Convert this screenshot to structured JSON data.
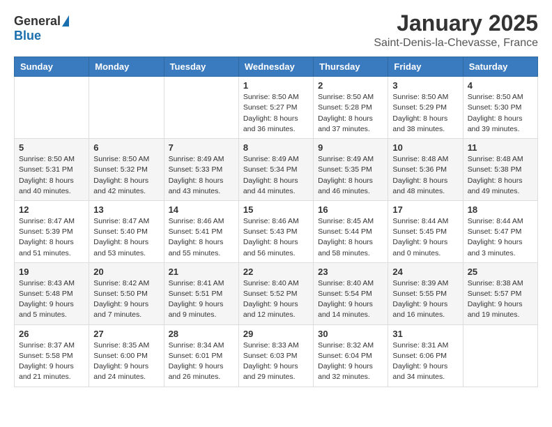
{
  "header": {
    "logo_general": "General",
    "logo_blue": "Blue",
    "title": "January 2025",
    "subtitle": "Saint-Denis-la-Chevasse, France"
  },
  "days_of_week": [
    "Sunday",
    "Monday",
    "Tuesday",
    "Wednesday",
    "Thursday",
    "Friday",
    "Saturday"
  ],
  "weeks": [
    [
      {
        "day": "",
        "info": ""
      },
      {
        "day": "",
        "info": ""
      },
      {
        "day": "",
        "info": ""
      },
      {
        "day": "1",
        "info": "Sunrise: 8:50 AM\nSunset: 5:27 PM\nDaylight: 8 hours and 36 minutes."
      },
      {
        "day": "2",
        "info": "Sunrise: 8:50 AM\nSunset: 5:28 PM\nDaylight: 8 hours and 37 minutes."
      },
      {
        "day": "3",
        "info": "Sunrise: 8:50 AM\nSunset: 5:29 PM\nDaylight: 8 hours and 38 minutes."
      },
      {
        "day": "4",
        "info": "Sunrise: 8:50 AM\nSunset: 5:30 PM\nDaylight: 8 hours and 39 minutes."
      }
    ],
    [
      {
        "day": "5",
        "info": "Sunrise: 8:50 AM\nSunset: 5:31 PM\nDaylight: 8 hours and 40 minutes."
      },
      {
        "day": "6",
        "info": "Sunrise: 8:50 AM\nSunset: 5:32 PM\nDaylight: 8 hours and 42 minutes."
      },
      {
        "day": "7",
        "info": "Sunrise: 8:49 AM\nSunset: 5:33 PM\nDaylight: 8 hours and 43 minutes."
      },
      {
        "day": "8",
        "info": "Sunrise: 8:49 AM\nSunset: 5:34 PM\nDaylight: 8 hours and 44 minutes."
      },
      {
        "day": "9",
        "info": "Sunrise: 8:49 AM\nSunset: 5:35 PM\nDaylight: 8 hours and 46 minutes."
      },
      {
        "day": "10",
        "info": "Sunrise: 8:48 AM\nSunset: 5:36 PM\nDaylight: 8 hours and 48 minutes."
      },
      {
        "day": "11",
        "info": "Sunrise: 8:48 AM\nSunset: 5:38 PM\nDaylight: 8 hours and 49 minutes."
      }
    ],
    [
      {
        "day": "12",
        "info": "Sunrise: 8:47 AM\nSunset: 5:39 PM\nDaylight: 8 hours and 51 minutes."
      },
      {
        "day": "13",
        "info": "Sunrise: 8:47 AM\nSunset: 5:40 PM\nDaylight: 8 hours and 53 minutes."
      },
      {
        "day": "14",
        "info": "Sunrise: 8:46 AM\nSunset: 5:41 PM\nDaylight: 8 hours and 55 minutes."
      },
      {
        "day": "15",
        "info": "Sunrise: 8:46 AM\nSunset: 5:43 PM\nDaylight: 8 hours and 56 minutes."
      },
      {
        "day": "16",
        "info": "Sunrise: 8:45 AM\nSunset: 5:44 PM\nDaylight: 8 hours and 58 minutes."
      },
      {
        "day": "17",
        "info": "Sunrise: 8:44 AM\nSunset: 5:45 PM\nDaylight: 9 hours and 0 minutes."
      },
      {
        "day": "18",
        "info": "Sunrise: 8:44 AM\nSunset: 5:47 PM\nDaylight: 9 hours and 3 minutes."
      }
    ],
    [
      {
        "day": "19",
        "info": "Sunrise: 8:43 AM\nSunset: 5:48 PM\nDaylight: 9 hours and 5 minutes."
      },
      {
        "day": "20",
        "info": "Sunrise: 8:42 AM\nSunset: 5:50 PM\nDaylight: 9 hours and 7 minutes."
      },
      {
        "day": "21",
        "info": "Sunrise: 8:41 AM\nSunset: 5:51 PM\nDaylight: 9 hours and 9 minutes."
      },
      {
        "day": "22",
        "info": "Sunrise: 8:40 AM\nSunset: 5:52 PM\nDaylight: 9 hours and 12 minutes."
      },
      {
        "day": "23",
        "info": "Sunrise: 8:40 AM\nSunset: 5:54 PM\nDaylight: 9 hours and 14 minutes."
      },
      {
        "day": "24",
        "info": "Sunrise: 8:39 AM\nSunset: 5:55 PM\nDaylight: 9 hours and 16 minutes."
      },
      {
        "day": "25",
        "info": "Sunrise: 8:38 AM\nSunset: 5:57 PM\nDaylight: 9 hours and 19 minutes."
      }
    ],
    [
      {
        "day": "26",
        "info": "Sunrise: 8:37 AM\nSunset: 5:58 PM\nDaylight: 9 hours and 21 minutes."
      },
      {
        "day": "27",
        "info": "Sunrise: 8:35 AM\nSunset: 6:00 PM\nDaylight: 9 hours and 24 minutes."
      },
      {
        "day": "28",
        "info": "Sunrise: 8:34 AM\nSunset: 6:01 PM\nDaylight: 9 hours and 26 minutes."
      },
      {
        "day": "29",
        "info": "Sunrise: 8:33 AM\nSunset: 6:03 PM\nDaylight: 9 hours and 29 minutes."
      },
      {
        "day": "30",
        "info": "Sunrise: 8:32 AM\nSunset: 6:04 PM\nDaylight: 9 hours and 32 minutes."
      },
      {
        "day": "31",
        "info": "Sunrise: 8:31 AM\nSunset: 6:06 PM\nDaylight: 9 hours and 34 minutes."
      },
      {
        "day": "",
        "info": ""
      }
    ]
  ]
}
